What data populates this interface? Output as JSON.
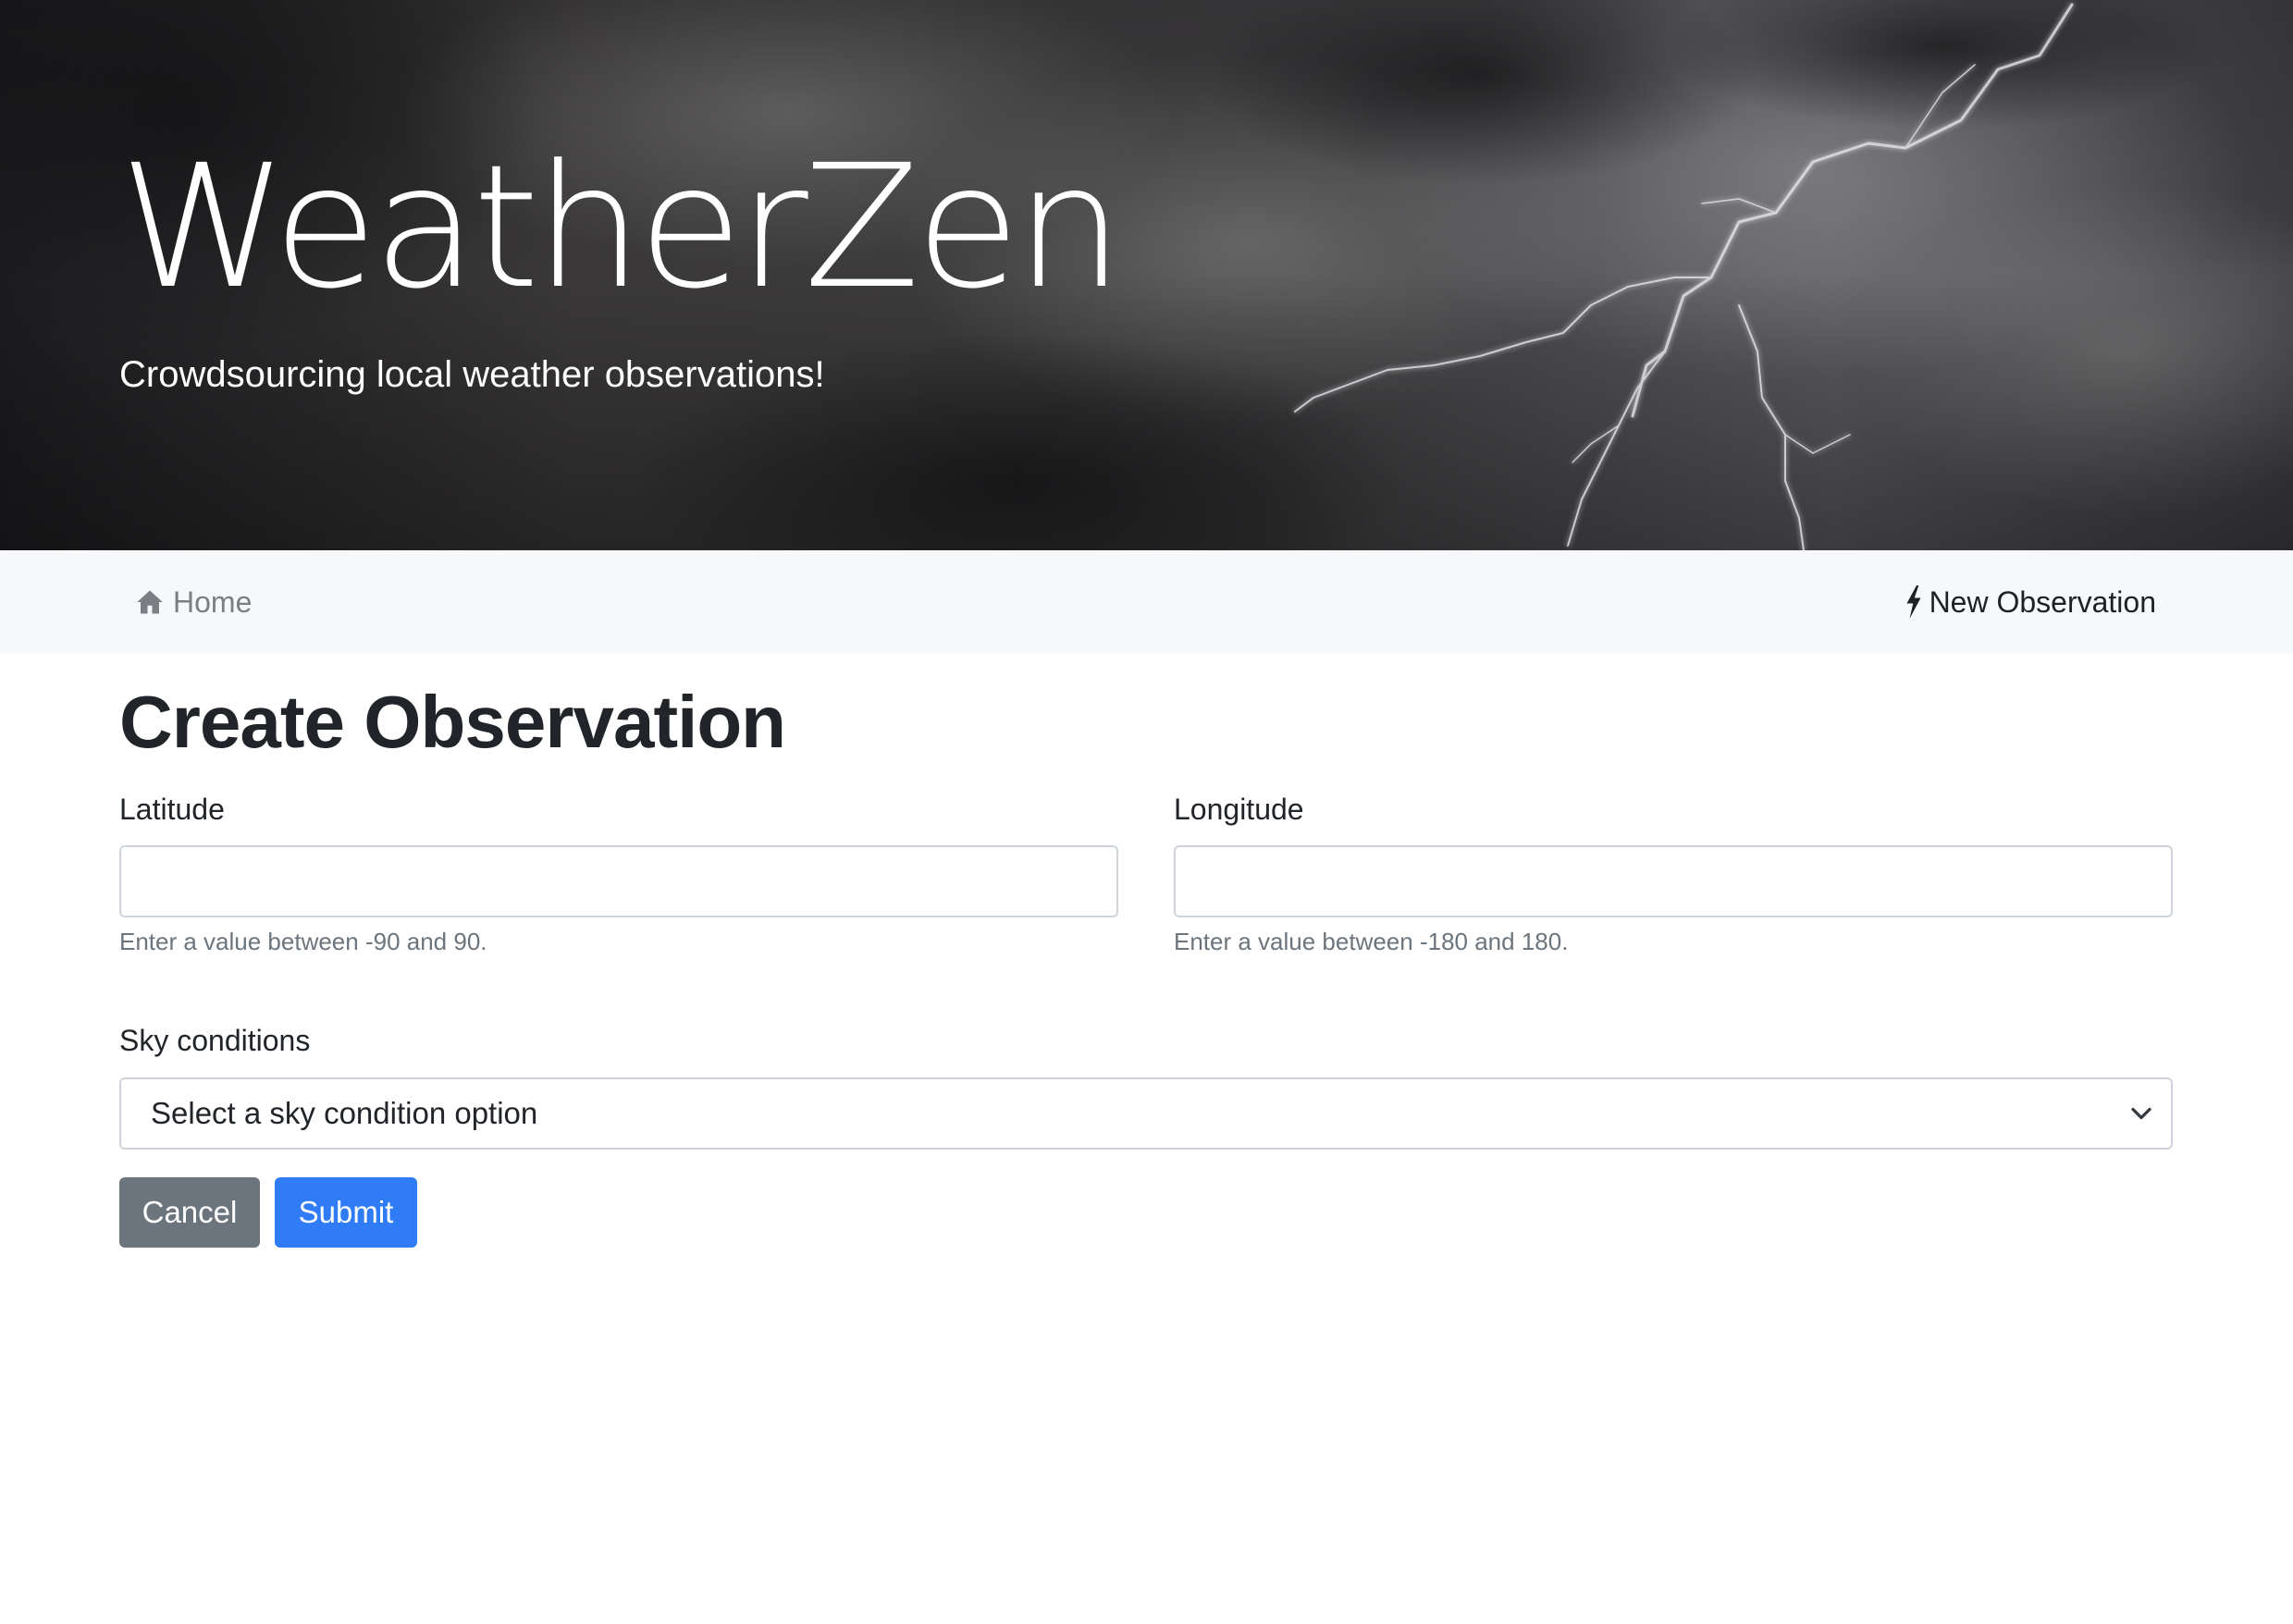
{
  "hero": {
    "title": "WeatherZen",
    "subtitle": "Crowdsourcing local weather observations!"
  },
  "navbar": {
    "home_icon": "home-icon",
    "home_label": "Home",
    "new_icon": "lightning-icon",
    "new_label": "New Observation"
  },
  "form": {
    "title": "Create Observation",
    "latitude": {
      "label": "Latitude",
      "value": "",
      "help": "Enter a value between -90 and 90."
    },
    "longitude": {
      "label": "Longitude",
      "value": "",
      "help": "Enter a value between -180 and 180."
    },
    "sky": {
      "label": "Sky conditions",
      "selected": "Select a sky condition option"
    },
    "cancel_label": "Cancel",
    "submit_label": "Submit"
  },
  "colors": {
    "primary": "#2f7cf6",
    "secondary": "#6c757d",
    "navbar_bg": "#f7f8f9"
  }
}
